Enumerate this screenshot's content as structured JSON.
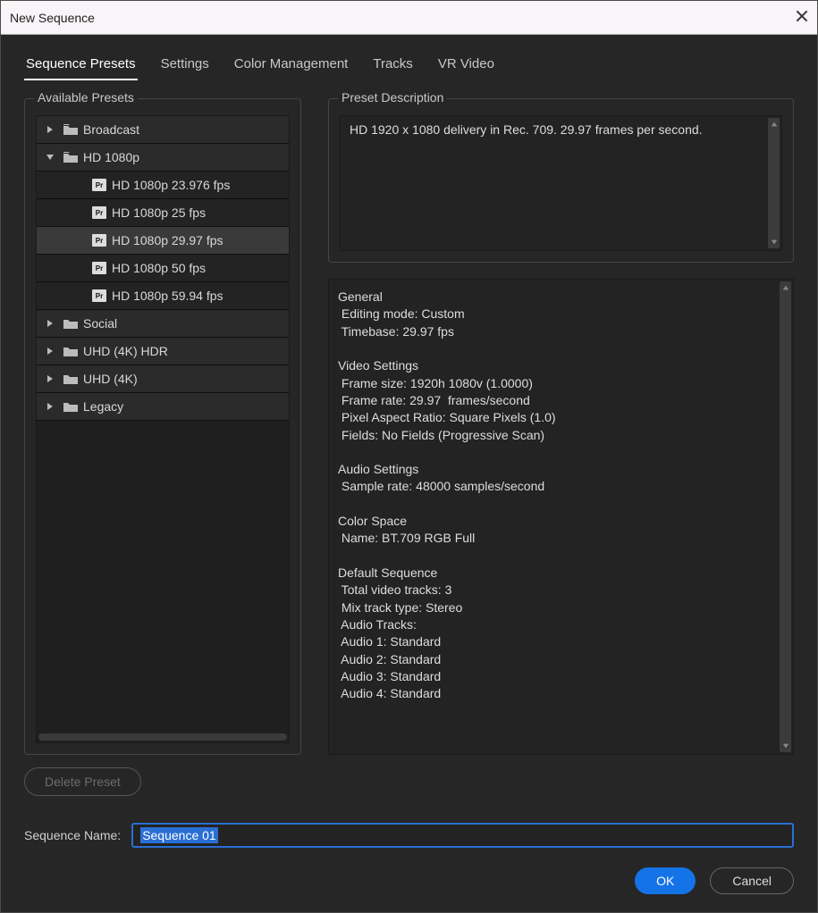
{
  "window": {
    "title": "New Sequence"
  },
  "tabs": [
    "Sequence Presets",
    "Settings",
    "Color Management",
    "Tracks",
    "VR Video"
  ],
  "active_tab": 0,
  "presets_label": "Available Presets",
  "desc_label": "Preset Description",
  "tree": {
    "folders": [
      {
        "label": "Broadcast",
        "expanded": false
      },
      {
        "label": "HD 1080p",
        "expanded": true,
        "children": [
          "HD 1080p 23.976 fps",
          "HD 1080p 25 fps",
          "HD 1080p 29.97 fps",
          "HD 1080p 50 fps",
          "HD 1080p 59.94 fps"
        ],
        "selected_index": 2
      },
      {
        "label": "Social",
        "expanded": false
      },
      {
        "label": "UHD (4K) HDR",
        "expanded": false
      },
      {
        "label": "UHD (4K)",
        "expanded": false
      },
      {
        "label": "Legacy",
        "expanded": false
      }
    ]
  },
  "description": "HD 1920 x 1080 delivery in Rec. 709. 29.97 frames per second.",
  "details": "General\n Editing mode: Custom\n Timebase: 29.97 fps\n\nVideo Settings\n Frame size: 1920h 1080v (1.0000)\n Frame rate: 29.97  frames/second\n Pixel Aspect Ratio: Square Pixels (1.0)\n Fields: No Fields (Progressive Scan)\n\nAudio Settings\n Sample rate: 48000 samples/second\n\nColor Space\n Name: BT.709 RGB Full\n\nDefault Sequence\n Total video tracks: 3\n Mix track type: Stereo\n Audio Tracks:\n Audio 1: Standard\n Audio 2: Standard\n Audio 3: Standard\n Audio 4: Standard",
  "delete_preset_label": "Delete Preset",
  "sequence_name_label": "Sequence Name:",
  "sequence_name_value": "Sequence 01",
  "ok_label": "OK",
  "cancel_label": "Cancel",
  "preset_icon_text": "Pr"
}
